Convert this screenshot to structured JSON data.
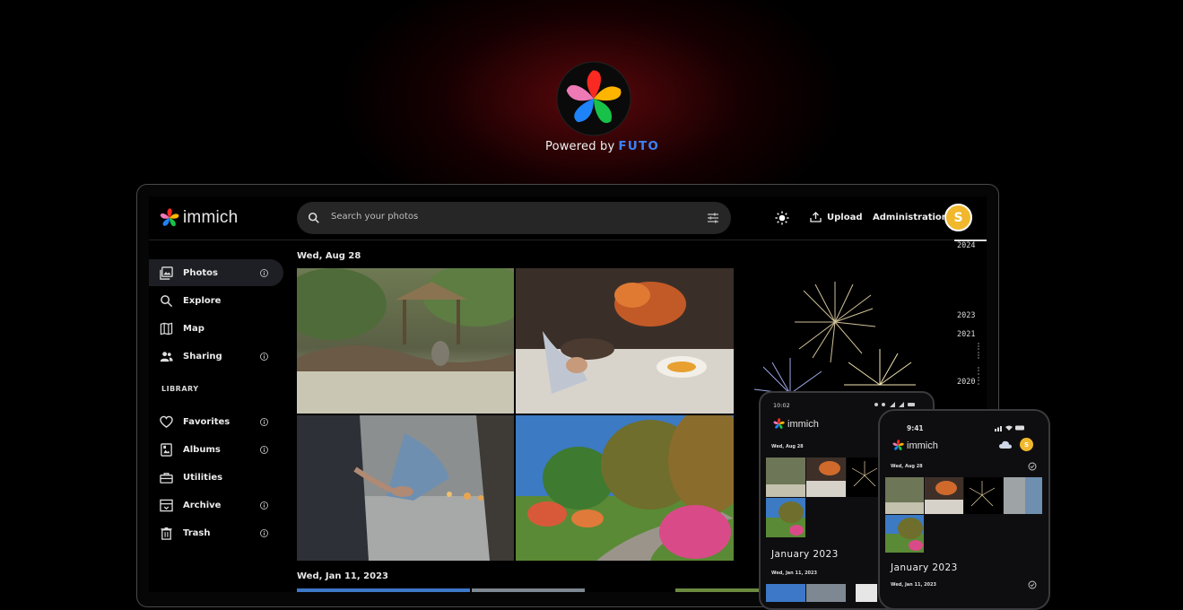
{
  "hero": {
    "powered_by": "Powered by",
    "partner": "FUTO"
  },
  "app": {
    "name": "immich",
    "search_placeholder": "Search your photos",
    "upload_label": "Upload",
    "admin_label": "Administration",
    "avatar_initial": "S"
  },
  "sidebar": {
    "items": [
      {
        "label": "Photos",
        "icon": "photos-icon",
        "active": true,
        "info": true
      },
      {
        "label": "Explore",
        "icon": "search-icon",
        "info": false
      },
      {
        "label": "Map",
        "icon": "map-icon",
        "info": false
      },
      {
        "label": "Sharing",
        "icon": "sharing-icon",
        "info": true
      }
    ],
    "library_heading": "LIBRARY",
    "library_items": [
      {
        "label": "Favorites",
        "icon": "heart-icon",
        "info": true
      },
      {
        "label": "Albums",
        "icon": "albums-icon",
        "info": true
      },
      {
        "label": "Utilities",
        "icon": "toolbox-icon",
        "info": false
      },
      {
        "label": "Archive",
        "icon": "archive-icon",
        "info": true
      },
      {
        "label": "Trash",
        "icon": "trash-icon",
        "info": true
      }
    ]
  },
  "timeline": {
    "groups": [
      {
        "date": "Wed, Aug 28"
      },
      {
        "date": "Wed, Jan 11, 2023"
      }
    ],
    "years": [
      "2024",
      "2023",
      "2021",
      "2020"
    ]
  },
  "phone_android": {
    "time": "10:02",
    "app_name": "immich",
    "date": "Wed, Aug 28",
    "month": "January 2023",
    "month_date": "Wed, Jan 11, 2023"
  },
  "phone_ios": {
    "time": "9:41",
    "app_name": "immich",
    "date": "Wed, Aug 28",
    "month": "January 2023",
    "month_date": "Wed, Jan 11, 2023"
  },
  "colors": {
    "accent_blue": "#3b82f6",
    "avatar_yellow": "#f1b82d",
    "active_nav": "#1e1f24"
  }
}
